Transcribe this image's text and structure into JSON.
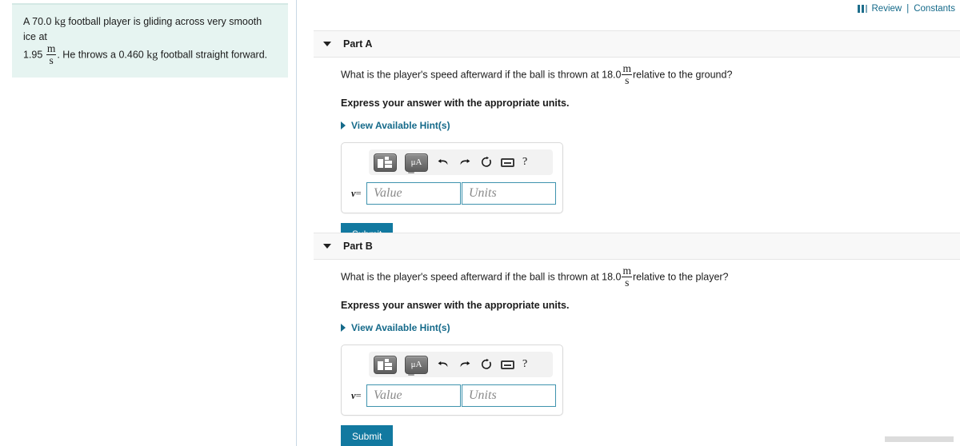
{
  "topbar": {
    "review_label": "Review",
    "separator": "|",
    "constants_label": "Constants",
    "icon": "book-icon",
    "link_color": "#156a8a"
  },
  "problem": {
    "line1_a": "A 70.0",
    "line1_unit": "kg",
    "line1_b": "football player is gliding across very smooth ice at",
    "line2_a": "1.95",
    "line2_unit_num": "m",
    "line2_unit_den": "s",
    "line2_b": ". He throws a 0.460",
    "line2_unit2": "kg",
    "line2_c": "football straight forward.",
    "background": "#e6f4f1"
  },
  "parts": [
    {
      "id": "part-a",
      "title": "Part A",
      "question_pre": "What is the player's speed afterward if the ball is thrown at 18.0",
      "question_unit_num": "m",
      "question_unit_den": "s",
      "question_post": "relative to the ground?",
      "instruction": "Express your answer with the appropriate units.",
      "hint_label": "View Available Hint(s)",
      "answer": {
        "variable": "v",
        "equals": "=",
        "value_placeholder": "Value",
        "value_text": "",
        "units_placeholder": "Units",
        "units_text": "",
        "toolbar": [
          {
            "name": "template-button",
            "glyph": "template"
          },
          {
            "name": "units-button",
            "glyph": "μA"
          },
          {
            "name": "undo-icon",
            "glyph": "undo"
          },
          {
            "name": "redo-icon",
            "glyph": "redo"
          },
          {
            "name": "reset-icon",
            "glyph": "reset"
          },
          {
            "name": "keyboard-icon",
            "glyph": "keyboard"
          },
          {
            "name": "help-icon",
            "glyph": "?"
          }
        ]
      },
      "submit_label": "Submit"
    },
    {
      "id": "part-b",
      "title": "Part B",
      "question_pre": "What is the player's speed afterward if the ball is thrown at 18.0",
      "question_unit_num": "m",
      "question_unit_den": "s",
      "question_post": "relative to the player?",
      "instruction": "Express your answer with the appropriate units.",
      "hint_label": "View Available Hint(s)",
      "answer": {
        "variable": "v",
        "equals": "=",
        "value_placeholder": "Value",
        "value_text": "",
        "units_placeholder": "Units",
        "units_text": "",
        "toolbar": [
          {
            "name": "template-button",
            "glyph": "template"
          },
          {
            "name": "units-button",
            "glyph": "μA"
          },
          {
            "name": "undo-icon",
            "glyph": "undo"
          },
          {
            "name": "redo-icon",
            "glyph": "redo"
          },
          {
            "name": "reset-icon",
            "glyph": "reset"
          },
          {
            "name": "keyboard-icon",
            "glyph": "keyboard"
          },
          {
            "name": "help-icon",
            "glyph": "?"
          }
        ]
      },
      "submit_label": "Submit"
    }
  ],
  "colors": {
    "accent_teal": "#1279a0",
    "link": "#156a8a",
    "input_border": "#3f93ae",
    "panel_bg": "#e6f4f1",
    "part_bar_bg": "#f8f8f8"
  }
}
